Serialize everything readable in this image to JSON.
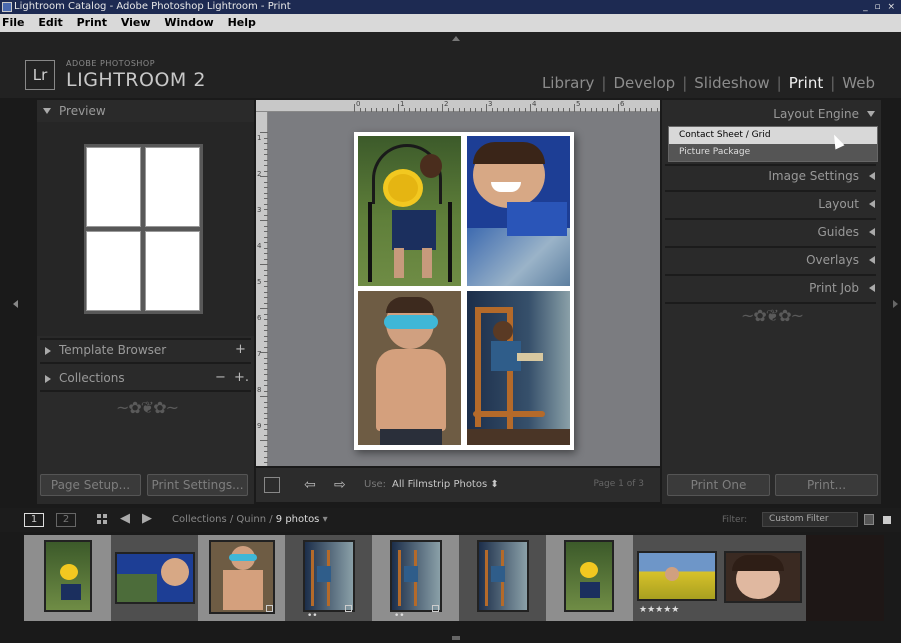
{
  "window": {
    "title": "Lightroom Catalog - Adobe Photoshop Lightroom - Print",
    "controls": "_ ▫ ×"
  },
  "menu": [
    "File",
    "Edit",
    "Print",
    "View",
    "Window",
    "Help"
  ],
  "brand": {
    "badge": "Lr",
    "small": "ADOBE PHOTOSHOP",
    "big": "LIGHTROOM 2"
  },
  "modules": {
    "items": [
      "Library",
      "Develop",
      "Slideshow",
      "Print",
      "Web"
    ],
    "active": "Print"
  },
  "left_panel": {
    "preview_label": "Preview",
    "template_browser": "Template Browser",
    "template_browser_plus": "+",
    "collections": "Collections",
    "collections_minus": "−",
    "collections_plus": "+.",
    "flourish": "~✿❦✿~",
    "page_setup": "Page Setup...",
    "print_settings": "Print Settings..."
  },
  "right_panel": {
    "layout_engine": "Layout Engine",
    "dropdown_options": [
      "Contact Sheet / Grid",
      "Picture Package"
    ],
    "selected_option": "Contact Sheet / Grid",
    "image_settings": "Image Settings",
    "layout": "Layout",
    "guides": "Guides",
    "overlays": "Overlays",
    "print_job": "Print Job",
    "flourish": "~✿❦✿~",
    "print_one": "Print One",
    "print": "Print..."
  },
  "toolbar": {
    "use_label": "Use:",
    "use_value": "All Filmstrip Photos ⬍",
    "page_info": "Page 1 of 3"
  },
  "ruler": {
    "top_numbers": [
      "0",
      "1",
      "2",
      "3",
      "4",
      "5",
      "6",
      "7"
    ],
    "left_numbers": [
      "1",
      "2",
      "3",
      "4",
      "5",
      "6",
      "7",
      "8",
      "9"
    ]
  },
  "filmbar": {
    "page1": "1",
    "page2": "2",
    "path_prefix": "Collections / Quinn / ",
    "path_count": "9 photos",
    "path_arrow": "▾",
    "filter_label": "Filter:",
    "filter_value": "Custom Filter",
    "nav_back": "◀",
    "nav_forward": "▶"
  },
  "filmstrip": {
    "count": 9,
    "selected_indices": [
      0,
      2,
      4,
      6
    ],
    "star_marks": "★★★★★",
    "dot_marks": "••"
  },
  "colors": {
    "accent_print": "#f0f0f0",
    "panel_bg": "#2a2a2a",
    "canvas_bg": "#7b7c80"
  }
}
